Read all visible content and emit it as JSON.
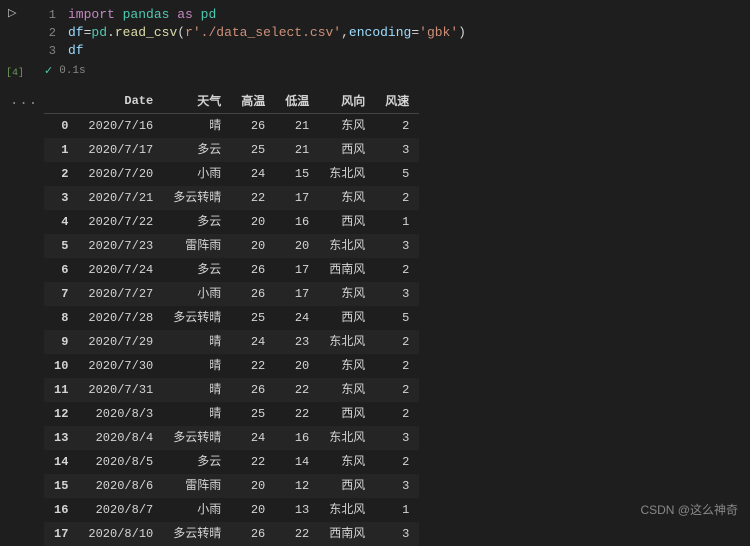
{
  "gutter": {
    "run_icon": "▷",
    "exec_count": "[4]",
    "dots": "..."
  },
  "code": {
    "lines": [
      {
        "num": "1",
        "parts": [
          {
            "cls": "kw",
            "t": "import"
          },
          {
            "cls": "op",
            "t": " "
          },
          {
            "cls": "mod",
            "t": "pandas"
          },
          {
            "cls": "op",
            "t": " "
          },
          {
            "cls": "kw",
            "t": "as"
          },
          {
            "cls": "op",
            "t": " "
          },
          {
            "cls": "mod",
            "t": "pd"
          }
        ]
      },
      {
        "num": "2",
        "parts": [
          {
            "cls": "var",
            "t": "df"
          },
          {
            "cls": "op",
            "t": "="
          },
          {
            "cls": "mod",
            "t": "pd"
          },
          {
            "cls": "op",
            "t": "."
          },
          {
            "cls": "func",
            "t": "read_csv"
          },
          {
            "cls": "op",
            "t": "("
          },
          {
            "cls": "str",
            "t": "r'./data_select.csv'"
          },
          {
            "cls": "op",
            "t": ","
          },
          {
            "cls": "var",
            "t": "encoding"
          },
          {
            "cls": "op",
            "t": "="
          },
          {
            "cls": "str",
            "t": "'gbk'"
          },
          {
            "cls": "op",
            "t": ")"
          }
        ]
      },
      {
        "num": "3",
        "parts": [
          {
            "cls": "var",
            "t": "df"
          }
        ]
      }
    ]
  },
  "status": {
    "check": "✓",
    "time": "0.1s"
  },
  "chart_data": {
    "type": "table",
    "columns": [
      "",
      "Date",
      "天气",
      "高温",
      "低温",
      "风向",
      "风速"
    ],
    "rows": [
      [
        "0",
        "2020/7/16",
        "晴",
        "26",
        "21",
        "东风",
        "2"
      ],
      [
        "1",
        "2020/7/17",
        "多云",
        "25",
        "21",
        "西风",
        "3"
      ],
      [
        "2",
        "2020/7/20",
        "小雨",
        "24",
        "15",
        "东北风",
        "5"
      ],
      [
        "3",
        "2020/7/21",
        "多云转晴",
        "22",
        "17",
        "东风",
        "2"
      ],
      [
        "4",
        "2020/7/22",
        "多云",
        "20",
        "16",
        "西风",
        "1"
      ],
      [
        "5",
        "2020/7/23",
        "雷阵雨",
        "20",
        "20",
        "东北风",
        "3"
      ],
      [
        "6",
        "2020/7/24",
        "多云",
        "26",
        "17",
        "西南风",
        "2"
      ],
      [
        "7",
        "2020/7/27",
        "小雨",
        "26",
        "17",
        "东风",
        "3"
      ],
      [
        "8",
        "2020/7/28",
        "多云转晴",
        "25",
        "24",
        "西风",
        "5"
      ],
      [
        "9",
        "2020/7/29",
        "晴",
        "24",
        "23",
        "东北风",
        "2"
      ],
      [
        "10",
        "2020/7/30",
        "晴",
        "22",
        "20",
        "东风",
        "2"
      ],
      [
        "11",
        "2020/7/31",
        "晴",
        "26",
        "22",
        "东风",
        "2"
      ],
      [
        "12",
        "2020/8/3",
        "晴",
        "25",
        "22",
        "西风",
        "2"
      ],
      [
        "13",
        "2020/8/4",
        "多云转晴",
        "24",
        "16",
        "东北风",
        "3"
      ],
      [
        "14",
        "2020/8/5",
        "多云",
        "22",
        "14",
        "东风",
        "2"
      ],
      [
        "15",
        "2020/8/6",
        "雷阵雨",
        "20",
        "12",
        "西风",
        "3"
      ],
      [
        "16",
        "2020/8/7",
        "小雨",
        "20",
        "13",
        "东北风",
        "1"
      ],
      [
        "17",
        "2020/8/10",
        "多云转晴",
        "26",
        "22",
        "西南风",
        "3"
      ]
    ]
  },
  "watermark": "CSDN @这么神奇"
}
